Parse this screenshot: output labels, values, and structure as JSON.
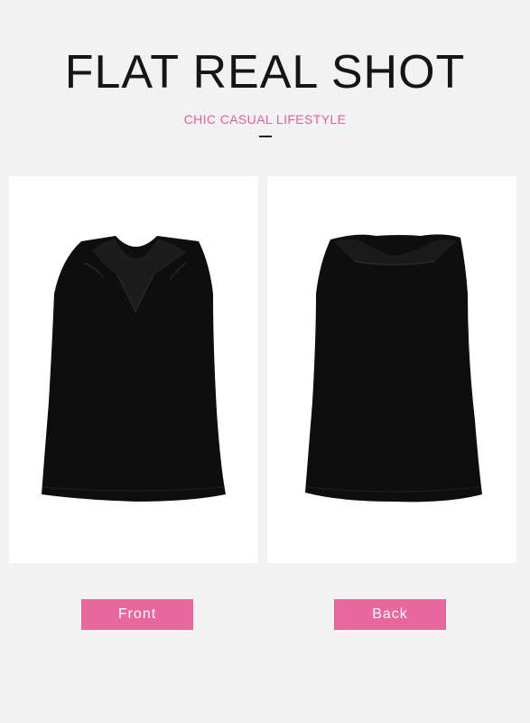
{
  "header": {
    "title": "FLAT REAL SHOT",
    "subtitle": "CHIC CASUAL LIFESTYLE"
  },
  "photos": [
    {
      "label": "Front"
    },
    {
      "label": "Back"
    }
  ],
  "colors": {
    "background": "#f2f2f2",
    "accent": "#e8689e",
    "subtitle_text": "#e0609a",
    "garment": "#0d0d0d"
  }
}
